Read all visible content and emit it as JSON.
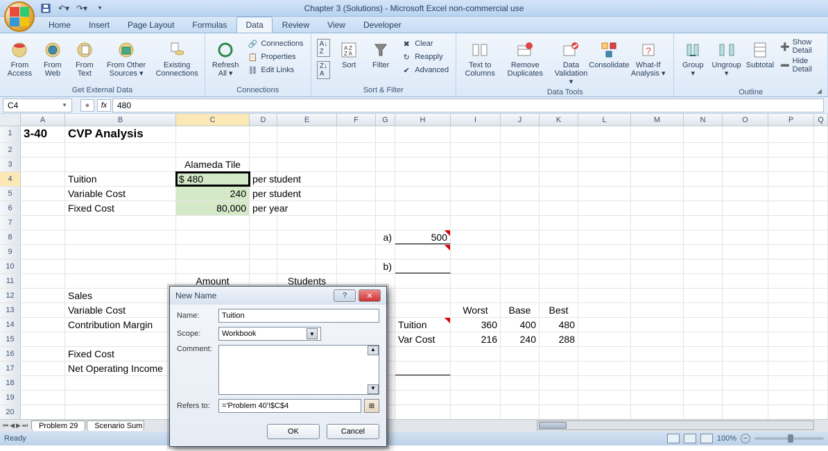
{
  "title": "Chapter 3 (Solutions)  -  Microsoft Excel non-commercial use",
  "tabs": [
    "Home",
    "Insert",
    "Page Layout",
    "Formulas",
    "Data",
    "Review",
    "View",
    "Developer"
  ],
  "active_tab": "Data",
  "ribbon": {
    "groups": {
      "ext_data": {
        "label": "Get External Data",
        "btns": [
          "From Access",
          "From Web",
          "From Text",
          "From Other Sources",
          "Existing Connections"
        ]
      },
      "connections": {
        "label": "Connections",
        "refresh": "Refresh All",
        "items": [
          "Connections",
          "Properties",
          "Edit Links"
        ]
      },
      "sort_filter": {
        "label": "Sort & Filter",
        "sort": "Sort",
        "filter": "Filter",
        "items": [
          "Clear",
          "Reapply",
          "Advanced"
        ]
      },
      "data_tools": {
        "label": "Data Tools",
        "btns": [
          "Text to Columns",
          "Remove Duplicates",
          "Data Validation",
          "Consolidate",
          "What-If Analysis"
        ]
      },
      "outline": {
        "label": "Outline",
        "btns": [
          "Group",
          "Ungroup",
          "Subtotal"
        ],
        "items": [
          "Show Detail",
          "Hide Detail"
        ]
      }
    }
  },
  "name_box": "C4",
  "formula_value": "480",
  "columns": [
    "A",
    "B",
    "C",
    "D",
    "E",
    "F",
    "G",
    "H",
    "I",
    "J",
    "K",
    "L",
    "M",
    "N",
    "O",
    "P",
    "Q"
  ],
  "sheet": {
    "r1": {
      "A": "3-40",
      "B": "CVP Analysis"
    },
    "r3": {
      "C": "Alameda Tile"
    },
    "r4": {
      "B": "Tuition",
      "C": " $              480",
      "D": "per student"
    },
    "r5": {
      "B": "Variable Cost",
      "C": "240",
      "D": "per student"
    },
    "r6": {
      "B": "Fixed Cost",
      "C": "80,000",
      "D": "per year"
    },
    "r8": {
      "G": "a)",
      "H": "500"
    },
    "r10": {
      "G": "b)"
    },
    "r11": {
      "C": "Amount",
      "E": "Students"
    },
    "r12": {
      "B": "Sales"
    },
    "r13": {
      "B": "Variable Cost",
      "I": "Worst",
      "J": "Base",
      "K": "Best"
    },
    "r14": {
      "B": "Contribution Margin",
      "H": "Tuition",
      "I": "360",
      "J": "400",
      "K": "480"
    },
    "r15": {
      "H": "Var Cost",
      "I": "216",
      "J": "240",
      "K": "288"
    },
    "r16": {
      "B": "Fixed Cost"
    },
    "r17": {
      "B": "Net Operating Income"
    }
  },
  "sheet_tabs": [
    "Problem 29",
    "Scenario Sum"
  ],
  "status": "Ready",
  "zoom": "100%",
  "dialog": {
    "title": "New Name",
    "name_lbl": "Name:",
    "name_val": "Tuition",
    "scope_lbl": "Scope:",
    "scope_val": "Workbook",
    "comment_lbl": "Comment:",
    "refers_lbl": "Refers to:",
    "refers_val": "='Problem 40'!$C$4",
    "ok": "OK",
    "cancel": "Cancel"
  }
}
